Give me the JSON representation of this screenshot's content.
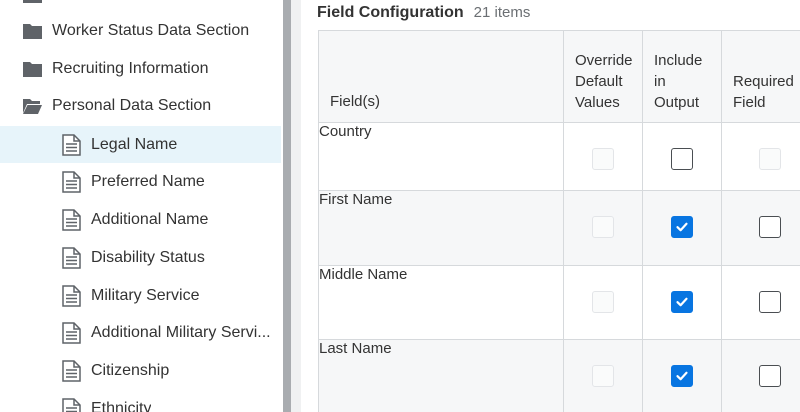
{
  "sidebar": {
    "items": [
      {
        "type": "folder",
        "label": "Worker Status Data Section",
        "selected": false
      },
      {
        "type": "folder",
        "label": "Recruiting Information",
        "selected": false
      },
      {
        "type": "folder-open",
        "label": "Personal Data Section",
        "selected": false
      },
      {
        "type": "doc",
        "label": "Legal Name",
        "selected": true
      },
      {
        "type": "doc",
        "label": "Preferred Name",
        "selected": false
      },
      {
        "type": "doc",
        "label": "Additional Name",
        "selected": false
      },
      {
        "type": "doc",
        "label": "Disability Status",
        "selected": false
      },
      {
        "type": "doc",
        "label": "Military Service",
        "selected": false
      },
      {
        "type": "doc",
        "label": "Additional Military Servi...",
        "selected": false
      },
      {
        "type": "doc",
        "label": "Citizenship",
        "selected": false
      },
      {
        "type": "doc",
        "label": "Ethnicity",
        "selected": false
      }
    ]
  },
  "main": {
    "title": "Field Configuration",
    "count": "21 items",
    "columns": {
      "field": "Field(s)",
      "override": [
        "Override",
        "Default",
        "Values"
      ],
      "include": [
        "Include",
        "in",
        "Output"
      ],
      "required": [
        "Required",
        "Field"
      ]
    },
    "rows": [
      {
        "field": "Country",
        "override": "disabled",
        "include": "unchecked",
        "required": "disabled"
      },
      {
        "field": "First Name",
        "override": "disabled",
        "include": "checked",
        "required": "unchecked"
      },
      {
        "field": "Middle Name",
        "override": "disabled",
        "include": "checked",
        "required": "unchecked"
      },
      {
        "field": "Last Name",
        "override": "disabled",
        "include": "checked",
        "required": "unchecked"
      }
    ]
  },
  "colors": {
    "accent": "#0875e1",
    "selected_row": "#e7f4fa",
    "header_bg": "#f6f7f8",
    "scrollbar": "#a9acb0"
  }
}
